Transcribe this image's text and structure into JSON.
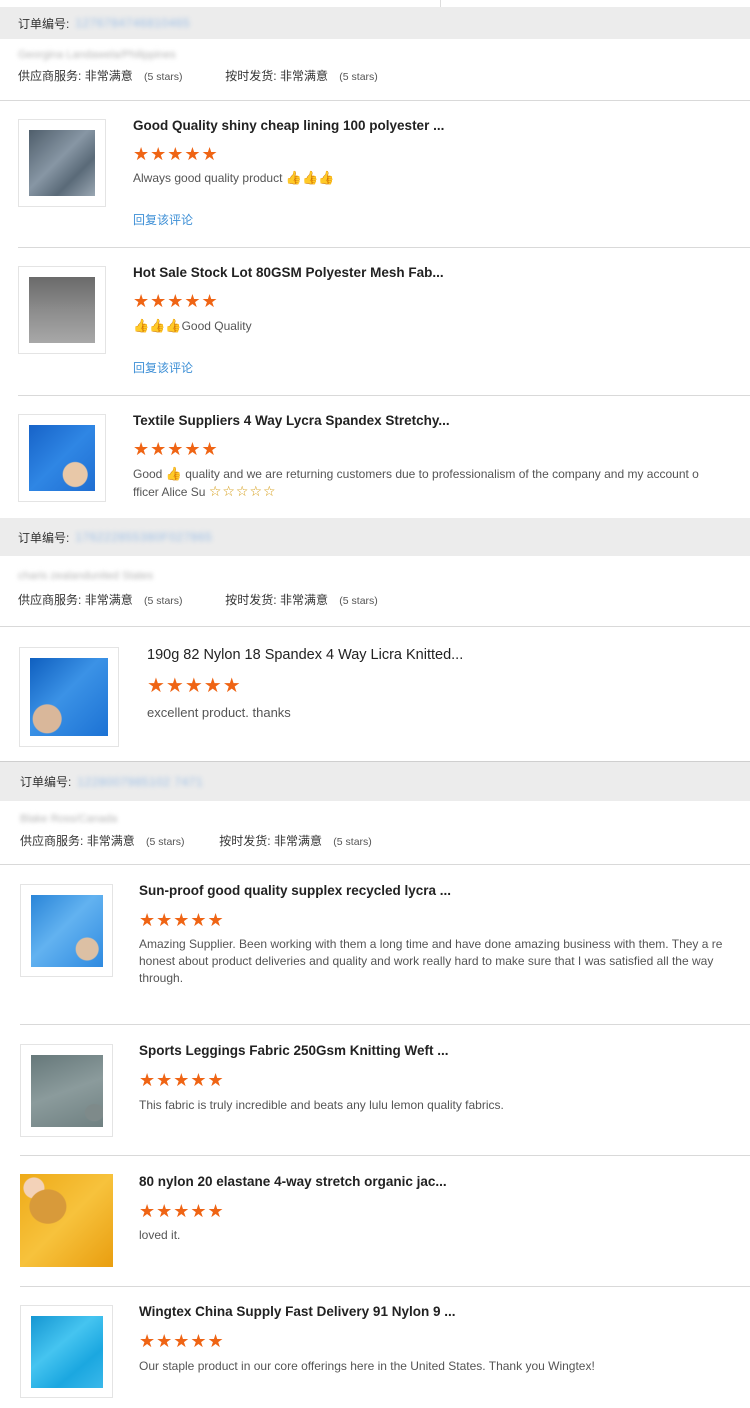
{
  "order_label": "订单编号:",
  "orders": [
    {
      "order_no": "1276784746810465",
      "buyer": "Georgina Landawela/Philippines",
      "supplier_service_label": "供应商服务:",
      "supplier_service_value": "非常满意",
      "supplier_service_stars": "(5 stars)",
      "shipping_label": "按时发货:",
      "shipping_value": "非常满意",
      "shipping_stars": "(5 stars)"
    },
    {
      "order_no": "176222855380F027865",
      "buyer": "charis zealandunited States",
      "supplier_service_label": "供应商服务:",
      "supplier_service_value": "非常满意",
      "supplier_service_stars": "(5 stars)",
      "shipping_label": "按时发货:",
      "shipping_value": "非常满意",
      "shipping_stars": "(5 stars)"
    },
    {
      "order_no": "1228007985102 7471",
      "buyer": "Blake Ross/Canada",
      "supplier_service_label": "供应商服务:",
      "supplier_service_value": "非常满意",
      "supplier_service_stars": "(5 stars)",
      "shipping_label": "按时发货:",
      "shipping_value": "非常满意",
      "shipping_stars": "(5 stars)"
    }
  ],
  "items": [
    {
      "title": "Good Quality shiny cheap lining 100 polyester ...",
      "stars": "★★★★★",
      "rating": 5,
      "comment": "Always good quality product ",
      "emoji": "👍👍👍",
      "reply": "回复该评论",
      "thumb_color": "#5e6e7c",
      "thumb_color2": "#8896a3"
    },
    {
      "title": "Hot Sale Stock Lot 80GSM Polyester Mesh Fab...",
      "stars": "★★★★★",
      "rating": 5,
      "comment": "Good Quality",
      "emoji": "👍👍👍",
      "reply": "回复该评论",
      "thumb_color": "#6f6f6f",
      "thumb_color2": "#9a9a9a"
    },
    {
      "title": "Textile Suppliers 4 Way Lycra Spandex Stretchy...",
      "stars": "★★★★★",
      "rating": 5,
      "comment_a": "Good ",
      "emoji": "👍",
      "comment_b": " quality and we are returning customers due to professionalism of the company and my account o",
      "comment_c": "fficer Alice Su ",
      "trailing_stars": "☆☆☆☆☆",
      "thumb_color": "#1d6fd8",
      "thumb_color2": "#3b8ae6"
    },
    {
      "title": "190g 82 Nylon 18 Spandex 4 Way Licra Knitted...",
      "stars": "★★★★★",
      "rating": 5,
      "comment": "excellent product. thanks",
      "thumb_color": "#1a78d4",
      "thumb_color2": "#47a0ee"
    },
    {
      "title": "Sun-proof good quality supplex recycled lycra ...",
      "stars": "★★★★★",
      "rating": 5,
      "comment": "Amazing Supplier. Been working with them a long time and have done amazing business with them. They a re honest about product deliveries and quality and work really hard to make sure that I was satisfied all the way through.",
      "thumb_color": "#2e8fe0",
      "thumb_color2": "#5fb0f0"
    },
    {
      "title": "Sports Leggings Fabric 250Gsm Knitting Weft ...",
      "stars": "★★★★★",
      "rating": 5,
      "comment": "This fabric is truly incredible and beats any lulu lemon quality fabrics.",
      "thumb_color": "#6e7a7c",
      "thumb_color2": "#8a9698"
    },
    {
      "title": "80 nylon 20 elastane 4-way stretch organic jac...",
      "stars": "★★★★★",
      "rating": 5,
      "comment": "loved it.",
      "thumb_color": "#f0a81a",
      "thumb_color2": "#f7c040"
    },
    {
      "title": "Wingtex China Supply Fast Delivery 91 Nylon 9 ...",
      "stars": "★★★★★",
      "rating": 5,
      "comment": "Our staple product in our core offerings here in the United States. Thank you Wingtex!",
      "thumb_color": "#1aa3dc",
      "thumb_color2": "#3fc0ee"
    }
  ],
  "icons": {
    "thumbs_up": "thumbs-up-icon",
    "star": "star-icon"
  }
}
